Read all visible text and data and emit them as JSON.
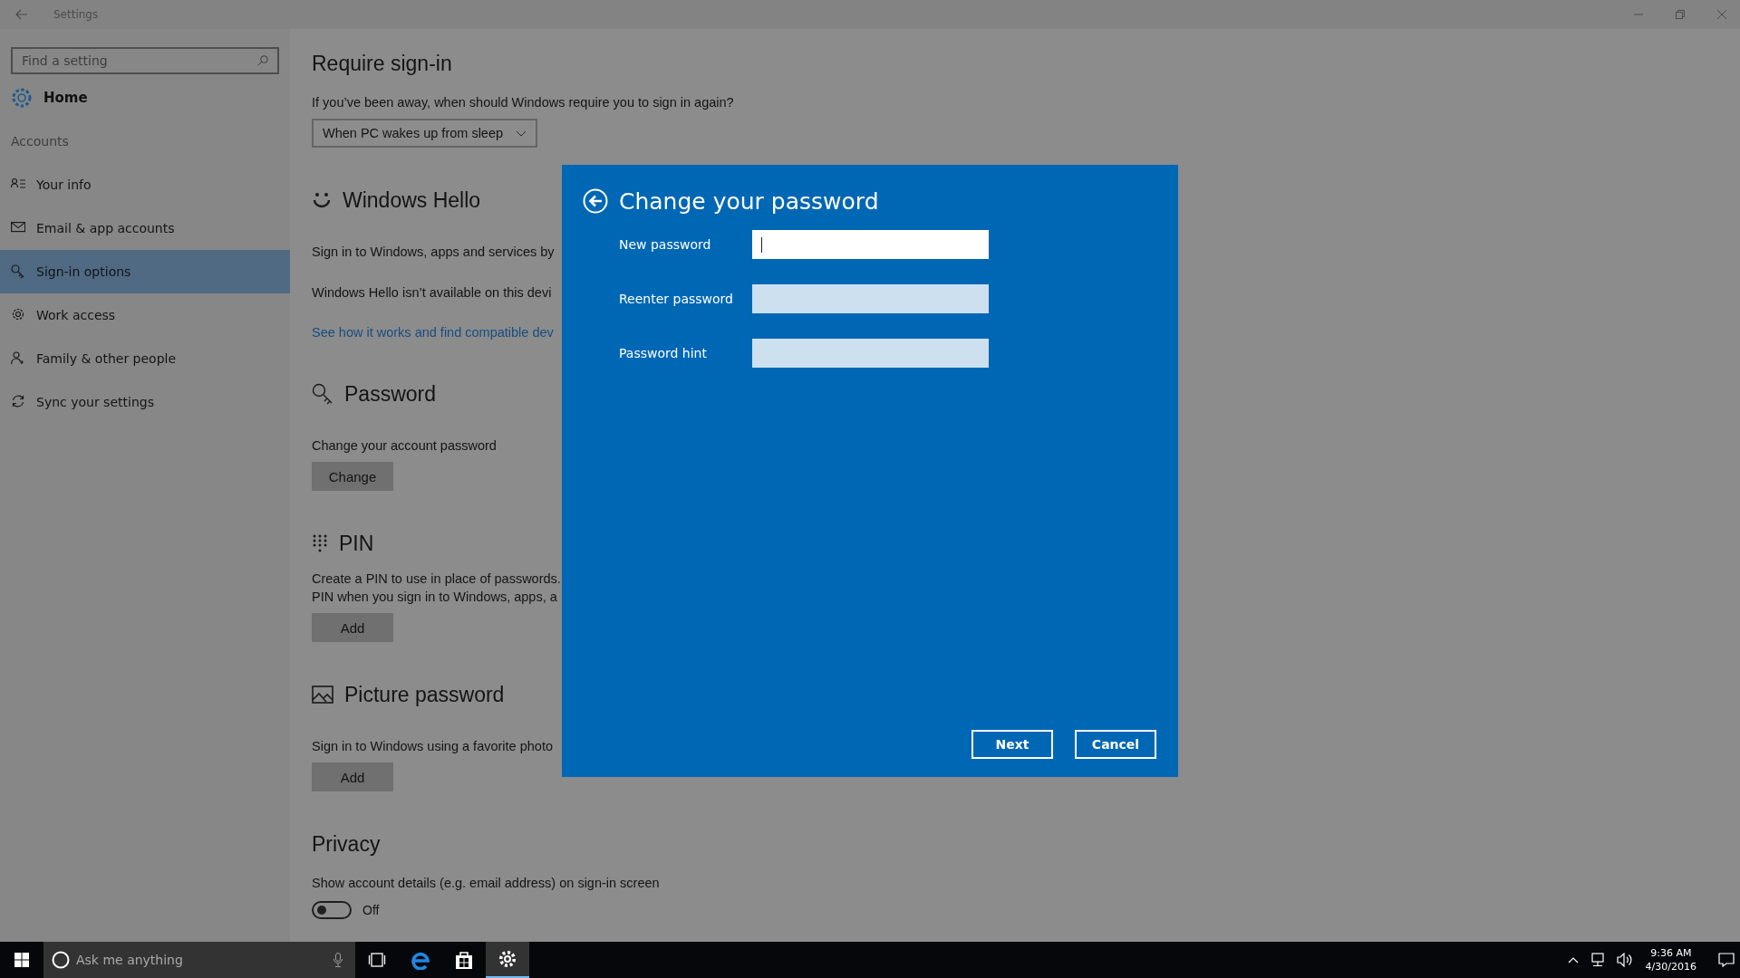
{
  "window": {
    "title": "Settings"
  },
  "sidebar": {
    "search": {
      "placeholder": "Find a setting"
    },
    "home": "Home",
    "section": "Accounts",
    "items": [
      {
        "label": "Your info",
        "kind": "info",
        "selected": false
      },
      {
        "label": "Email & app accounts",
        "kind": "email",
        "selected": false
      },
      {
        "label": "Sign-in options",
        "kind": "key",
        "selected": true
      },
      {
        "label": "Work access",
        "kind": "gear",
        "selected": false
      },
      {
        "label": "Family & other people",
        "kind": "people",
        "selected": false
      },
      {
        "label": "Sync your settings",
        "kind": "sync",
        "selected": false
      }
    ]
  },
  "content": {
    "sections": [
      {
        "heading": "Require sign-in",
        "blocks": [
          {
            "kind": "text",
            "text": "If you’ve been away, when should Windows require you to sign in again?"
          },
          {
            "kind": "dropdown",
            "text": "When PC wakes up from sleep"
          }
        ]
      },
      {
        "heading": "Windows Hello",
        "blocks": [
          {
            "kind": "text",
            "text": "Sign in to Windows, apps and services by"
          },
          {
            "kind": "text",
            "text": "Windows Hello isn’t available on this devi"
          },
          {
            "kind": "link",
            "text": "See how it works and find compatible dev"
          }
        ]
      },
      {
        "heading": "Password",
        "blocks": [
          {
            "kind": "text",
            "text": "Change your account password"
          },
          {
            "kind": "button",
            "text": "Change"
          }
        ]
      },
      {
        "heading": "PIN",
        "blocks": [
          {
            "kind": "paragraph",
            "lines": [
              "Create a PIN to use in place of passwords.",
              "PIN when you sign in to Windows, apps, a"
            ]
          },
          {
            "kind": "button",
            "text": "Add"
          }
        ]
      },
      {
        "heading": "Picture password",
        "blocks": [
          {
            "kind": "text",
            "text": "Sign in to Windows using a favorite photo"
          },
          {
            "kind": "button",
            "text": "Add"
          }
        ]
      },
      {
        "heading": "Privacy",
        "blocks": [
          {
            "kind": "text",
            "text": "Show account details (e.g. email address) on sign-in screen"
          },
          {
            "kind": "toggle",
            "on": false,
            "text": "Off"
          }
        ]
      }
    ]
  },
  "dialog": {
    "title": "Change your password",
    "fields": [
      {
        "label": "New password",
        "focused": true
      },
      {
        "label": "Reenter password",
        "focused": false
      },
      {
        "label": "Password hint",
        "focused": false
      }
    ],
    "buttons": [
      "Next",
      "Cancel"
    ]
  },
  "taskbar": {
    "search": {
      "placeholder": "Ask me anything"
    },
    "apps": [
      {
        "kind": "taskview",
        "selected": false
      },
      {
        "kind": "browser",
        "selected": false
      },
      {
        "kind": "store",
        "selected": false
      },
      {
        "kind": "settings",
        "selected": true
      }
    ],
    "clock": {
      "time": "9:36 AM",
      "date": "4/30/2016"
    }
  }
}
